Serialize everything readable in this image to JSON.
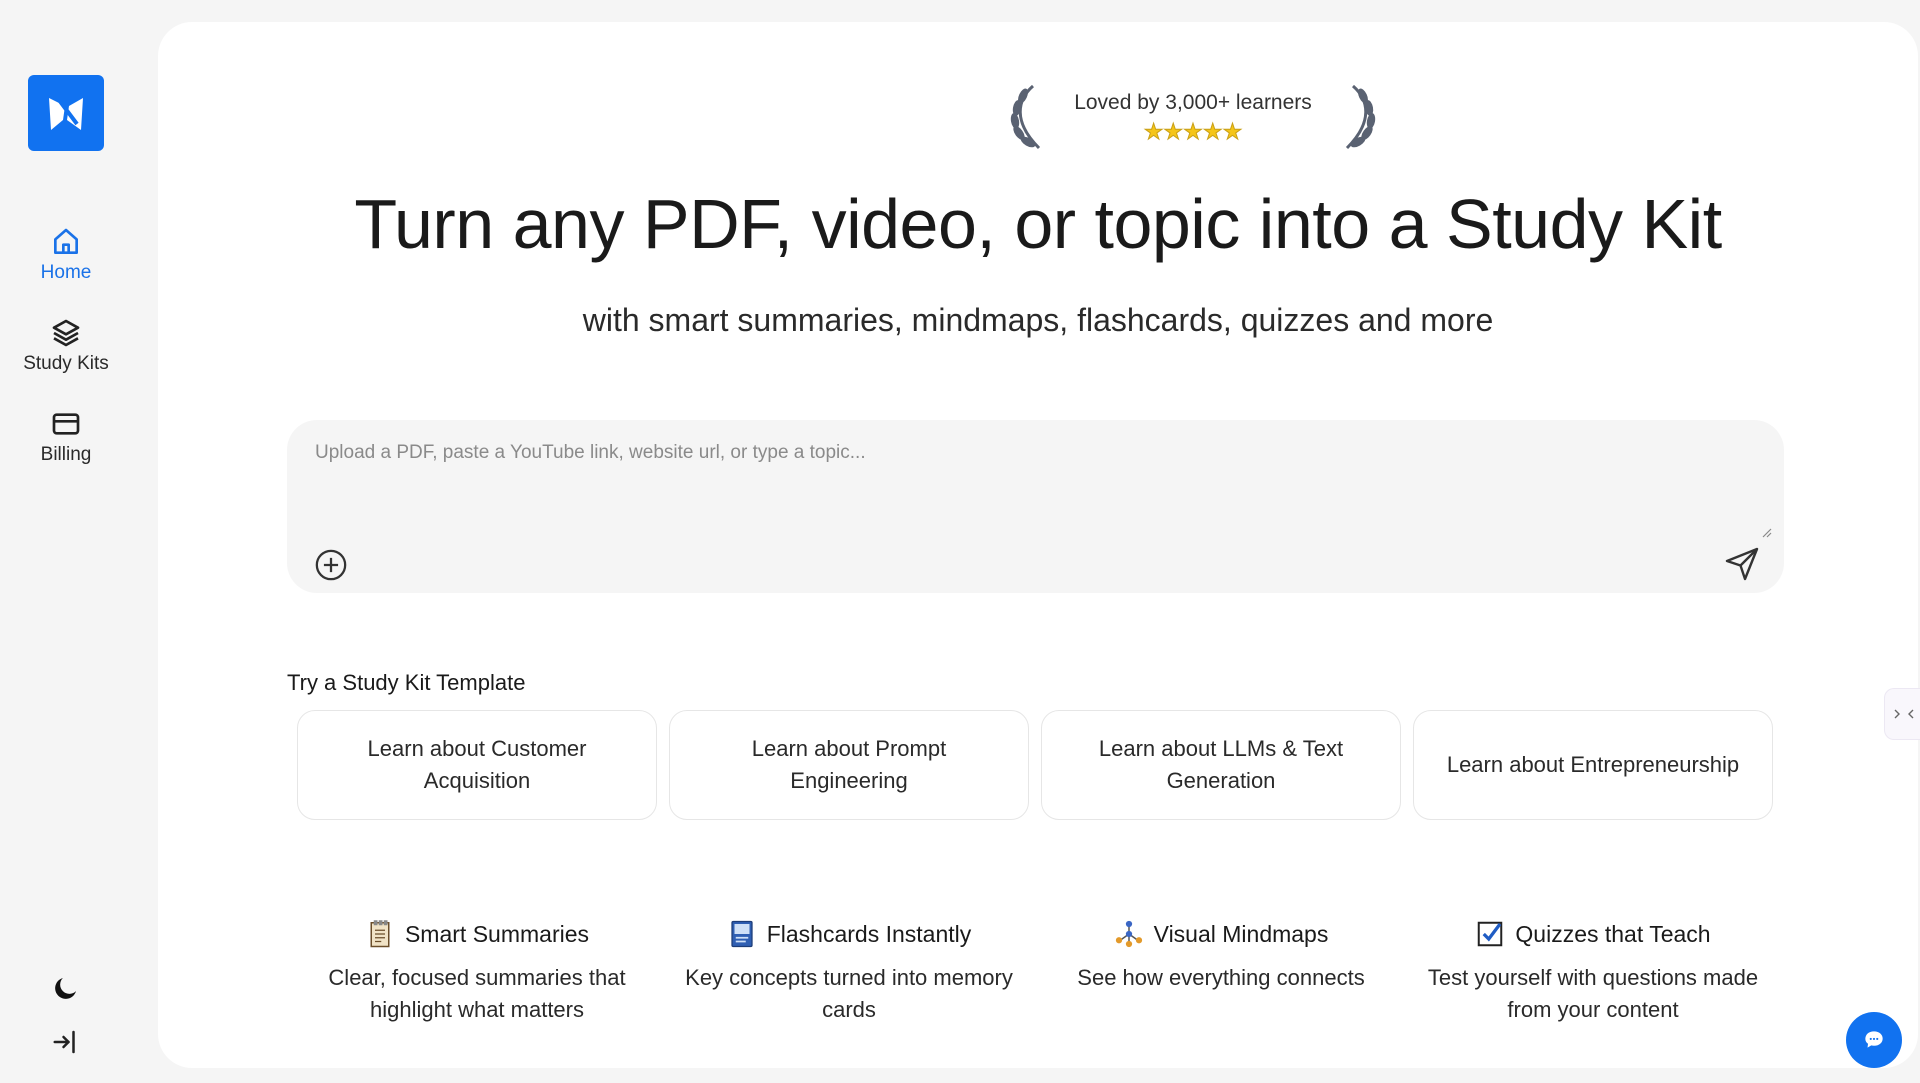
{
  "sidebar": {
    "logo_icon": "app-logo-icon",
    "items": [
      {
        "label": "Home",
        "icon": "home-icon",
        "active": true
      },
      {
        "label": "Study Kits",
        "icon": "layers-icon",
        "active": false
      },
      {
        "label": "Billing",
        "icon": "credit-card-icon",
        "active": false
      }
    ],
    "bottom": [
      {
        "icon": "moon-icon"
      },
      {
        "icon": "sign-in-icon"
      }
    ]
  },
  "hero": {
    "badge_text": "Loved by 3,000+ learners",
    "stars": "★★★★★",
    "headline": "Turn any PDF, video, or topic into a Study Kit",
    "subline": "with smart summaries, mindmaps, flashcards, quizzes and more"
  },
  "input": {
    "placeholder": "Upload a PDF, paste a YouTube link, website url, or type a topic...",
    "value": ""
  },
  "templates": {
    "title": "Try a Study Kit Template",
    "items": [
      "Learn about Customer Acquisition",
      "Learn about Prompt Engineering",
      "Learn about LLMs & Text Generation",
      "Learn about Entrepreneurship"
    ]
  },
  "features": [
    {
      "title": "Smart Summaries",
      "desc": "Clear, focused summaries that highlight what matters",
      "icon": "notebook-icon"
    },
    {
      "title": "Flashcards Instantly",
      "desc": "Key concepts turned into memory cards",
      "icon": "flashcard-icon"
    },
    {
      "title": "Visual Mindmaps",
      "desc": "See how everything connects",
      "icon": "mindmap-icon"
    },
    {
      "title": "Quizzes that Teach",
      "desc": "Test yourself with questions made from your content",
      "icon": "quiz-check-icon"
    }
  ],
  "colors": {
    "accent": "#1172f0",
    "background": "#f5f5f5",
    "card": "#ffffff"
  }
}
